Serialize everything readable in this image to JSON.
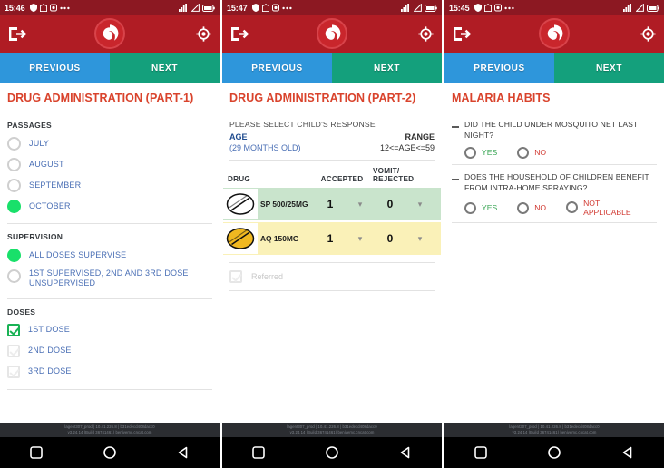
{
  "panels": [
    {
      "status": {
        "time": "15:46",
        "icons": [
          "shield-icon",
          "shirt-icon",
          "camera-icon",
          "more-icon"
        ],
        "right_icons": [
          "signal-icon",
          "wifi-icon",
          "battery-icon"
        ]
      },
      "appbar": {
        "left_icon": "logout-icon",
        "right_icon": "location-target-icon",
        "logo": "brand-logo"
      },
      "nav": {
        "previous": "PREVIOUS",
        "next": "NEXT"
      },
      "title": "DRUG ADMINISTRATION (PART-1)",
      "groups": [
        {
          "label": "PASSAGES",
          "type": "radio",
          "options": [
            {
              "label": "JULY",
              "selected": false
            },
            {
              "label": "AUGUST",
              "selected": false
            },
            {
              "label": "SEPTEMBER",
              "selected": false
            },
            {
              "label": "OCTOBER",
              "selected": true
            }
          ]
        },
        {
          "label": "SUPERVISION",
          "type": "radio",
          "options": [
            {
              "label": "ALL DOSES SUPERVISE",
              "selected": true
            },
            {
              "label": "1ST SUPERVISED, 2ND AND 3RD DOSE UNSUPERVISED",
              "selected": false
            }
          ]
        },
        {
          "label": "DOSES",
          "type": "checkbox",
          "options": [
            {
              "label": "1ST DOSE",
              "checked": true,
              "faint": false
            },
            {
              "label": "2ND DOSE",
              "checked": false,
              "faint": true
            },
            {
              "label": "3RD DOSE",
              "checked": false,
              "faint": true
            }
          ]
        }
      ],
      "footer": {
        "build_line1": "lagent307_prod | 10.41.226.8 | b31edecd408dacc0",
        "build_line2": "v3.24.14 (Build 36741461) benivemc.cncat.com",
        "nav_icons": [
          "square-recents-icon",
          "circle-home-icon",
          "triangle-back-icon"
        ]
      }
    },
    {
      "status": {
        "time": "15:47",
        "icons": [
          "shield-icon",
          "shirt-icon",
          "camera-icon",
          "more-icon"
        ],
        "right_icons": [
          "signal-icon",
          "wifi-icon",
          "battery-icon"
        ]
      },
      "appbar": {
        "left_icon": "logout-icon",
        "right_icon": "location-target-icon",
        "logo": "brand-logo"
      },
      "nav": {
        "previous": "PREVIOUS",
        "next": "NEXT"
      },
      "title": "DRUG ADMINISTRATION (PART-2)",
      "prompt": "PLEASE SELECT CHILD'S RESPONSE",
      "age_label": "AGE",
      "range_label": "RANGE",
      "age_value": "(29 MONTHS OLD)",
      "range_value": "12<=AGE<=59",
      "table": {
        "headers": {
          "drug": "DRUG",
          "accepted": "ACCEPTED",
          "vomit": "VOMIT/ REJECTED"
        },
        "rows": [
          {
            "name": "SP 500/25MG",
            "accepted": "1",
            "vomit": "0",
            "pill": "white-pill-icon",
            "row_color": "green"
          },
          {
            "name": "AQ 150MG",
            "accepted": "1",
            "vomit": "0",
            "pill": "yellow-pill-icon",
            "row_color": "yellow"
          }
        ]
      },
      "referred": {
        "label": "Referred",
        "checked": false
      },
      "footer": {
        "build_line1": "lagent307_prod | 10.41.226.8 | b31edecd408dacc0",
        "build_line2": "v3.24.14 (Build 36741461) benivemc.cncat.com",
        "nav_icons": [
          "square-recents-icon",
          "circle-home-icon",
          "triangle-back-icon"
        ]
      }
    },
    {
      "status": {
        "time": "15:45",
        "icons": [
          "shield-icon",
          "shirt-icon",
          "camera-icon",
          "more-icon"
        ],
        "right_icons": [
          "signal-icon",
          "wifi-icon",
          "battery-icon"
        ]
      },
      "appbar": {
        "left_icon": "logout-icon",
        "right_icon": "location-target-icon",
        "logo": "brand-logo"
      },
      "nav": {
        "previous": "PREVIOUS",
        "next": "NEXT"
      },
      "title": "MALARIA HABITS",
      "questions": [
        {
          "text": "DID THE CHILD UNDER MOSQUITO NET LAST NIGHT?",
          "answers": [
            {
              "label": "YES",
              "tone": "yes",
              "selected": false
            },
            {
              "label": "NO",
              "tone": "no",
              "selected": false
            }
          ]
        },
        {
          "text": "DOES THE HOUSEHOLD OF CHILDREN BENEFIT FROM INTRA-HOME SPRAYING?",
          "answers": [
            {
              "label": "YES",
              "tone": "yes",
              "selected": false
            },
            {
              "label": "NO",
              "tone": "no",
              "selected": false
            },
            {
              "label": "NOT APPLICABLE",
              "tone": "no",
              "selected": false
            }
          ]
        }
      ],
      "footer": {
        "build_line1": "lagent307_prod | 10.41.226.8 | b31edecd408dacc0",
        "build_line2": "v3.24.14 (Build 36741461) benivemc.cncat.com",
        "nav_icons": [
          "square-recents-icon",
          "circle-home-icon",
          "triangle-back-icon"
        ]
      }
    }
  ],
  "colors": {
    "statusbar": "#8c1822",
    "appbar": "#b01c24",
    "previous": "#2e96db",
    "next": "#14a07c",
    "title": "#d9432c",
    "selected_radio": "#19e06a",
    "row_green": "#c9e4cc",
    "row_yellow": "#faf1b8",
    "yes": "#3aa655",
    "no": "#d13a32"
  }
}
